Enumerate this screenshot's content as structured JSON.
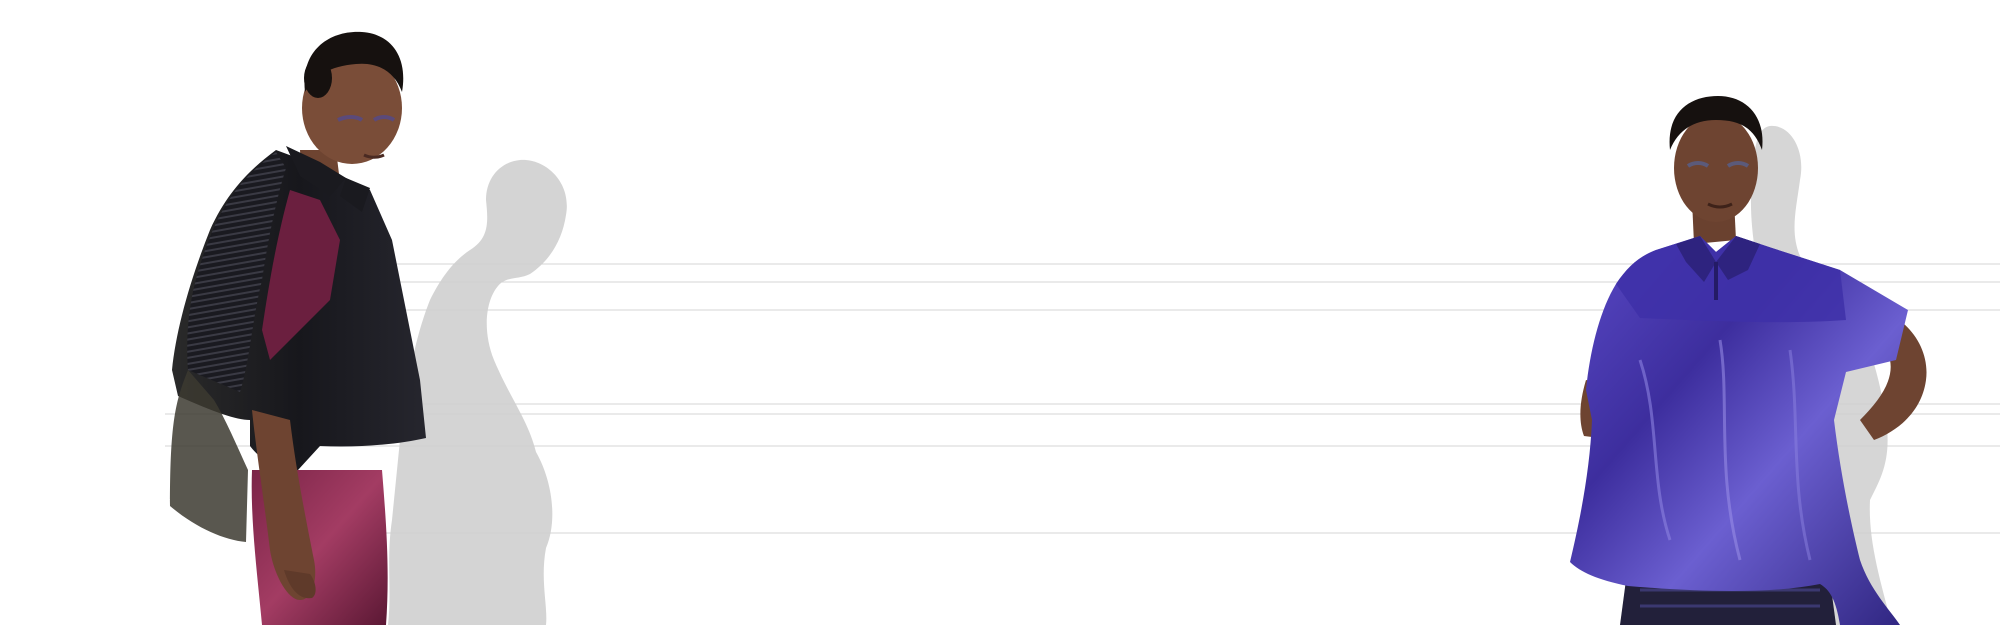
{
  "scene": {
    "background_color": "#ffffff",
    "figures": [
      {
        "name": "model-left",
        "garment_colors": [
          "#1b1b22",
          "#6b1f3f",
          "#8a2d52"
        ],
        "skin_color": "#7a4d38",
        "hair_color": "#16110f"
      },
      {
        "name": "model-right",
        "garment_colors": [
          "#3f2fa3",
          "#4b3bb5",
          "#22203a"
        ],
        "skin_color": "#6e4431",
        "hair_color": "#16110f"
      }
    ],
    "shadow_color": "#c9c9c9",
    "line_color": "#d6d6d6"
  }
}
